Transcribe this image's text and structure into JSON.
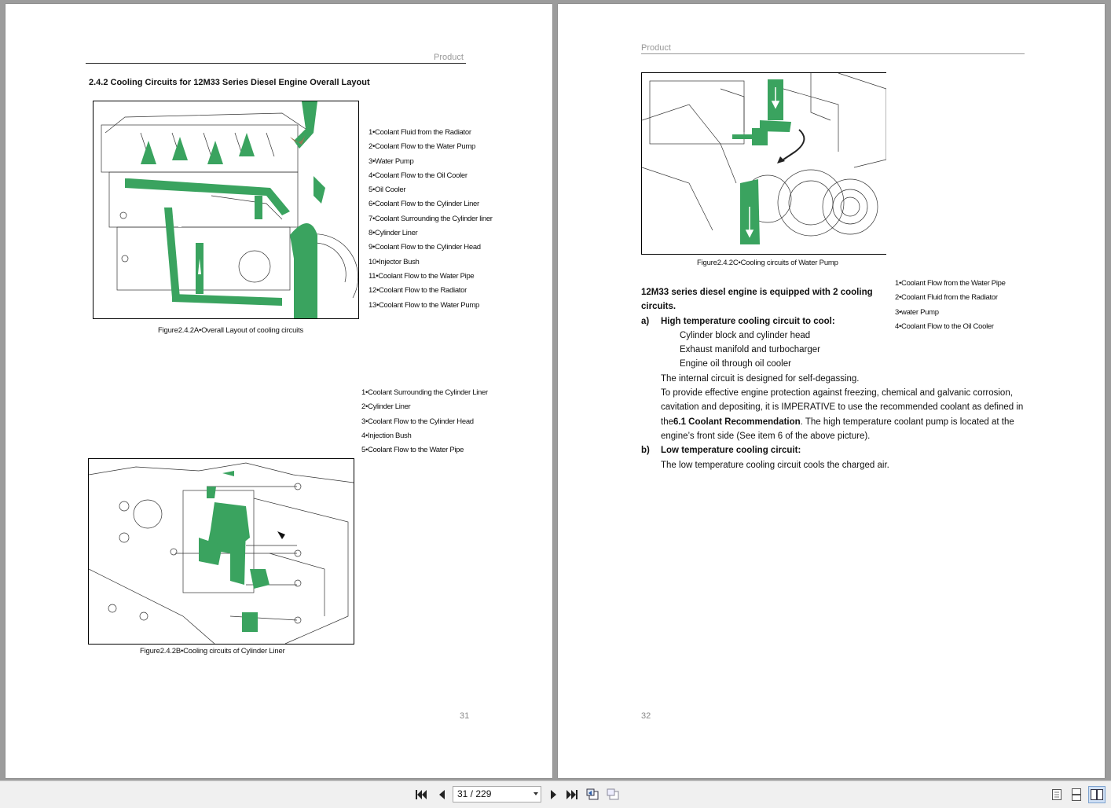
{
  "left_page": {
    "header": "Product",
    "section_title": "2.4.2 Cooling Circuits for 12M33 Series Diesel Engine Overall Layout",
    "figure_a_legend": [
      "1•Coolant Fluid from the Radiator",
      "2•Coolant Flow to the Water Pump",
      "3•Water Pump",
      "4•Coolant Flow to the Oil Cooler",
      "5•Oil Cooler",
      "6•Coolant Flow to the Cylinder Liner",
      "7•Coolant Surrounding the Cylinder liner",
      "8•Cylinder Liner",
      "9•Coolant Flow to the Cylinder Head",
      "10•Injector Bush",
      "11•Coolant Flow to the Water Pipe",
      "12•Coolant Flow to the Radiator",
      "13•Coolant Flow to the Water Pump"
    ],
    "figure_a_caption": "Figure2.4.2A•Overall Layout of cooling circuits",
    "figure_b_legend": [
      "1•Coolant Surrounding the Cylinder Liner",
      "2•Cylinder Liner",
      "3•Coolant Flow to the Cylinder Head",
      "4•Injection Bush",
      "5•Coolant Flow to the Water Pipe"
    ],
    "figure_b_caption": "Figure2.4.2B•Cooling circuits of Cylinder Liner",
    "page_number": "31"
  },
  "right_page": {
    "header": "Product",
    "figure_c_caption": "Figure2.4.2C•Cooling circuits of Water Pump",
    "figure_c_legend": [
      "1•Coolant Flow from the Water Pipe",
      "2•Coolant Fluid from the Radiator",
      "3•water Pump",
      "4•Coolant Flow to the Oil Cooler"
    ],
    "intro_line1": "12M33 series diesel engine is equipped with 2 cooling",
    "intro_line2": "circuits.",
    "item_a_marker": "a)",
    "item_a_title": "High temperature cooling circuit to cool:",
    "bullet_char": "",
    "bullets": [
      "Cylinder block and cylinder head",
      "Exhaust manifold and turbocharger",
      "Engine oil through oil cooler"
    ],
    "para1": "The internal circuit is designed for self-degassing.",
    "para2_line1": "To provide effective engine protection against freezing, chemical and galvanic corrosion,",
    "para2_line2": "cavitation and depositing, it is IMPERATIVE to use the recommended coolant as defined in",
    "para2_line3_pre": "the",
    "para2_line3_bold": "6.1 Coolant Recommendation",
    "para2_line3_post": ". The high temperature coolant pump is located at the",
    "para2_line4": "engine’s front side (See item 6 of the above picture).",
    "item_b_marker": "b)",
    "item_b_title": "Low temperature cooling circuit:",
    "item_b_text": "The low temperature cooling circuit cools the charged air.",
    "page_number": "32"
  },
  "toolbar": {
    "page_indicator": "31 / 229"
  },
  "colors": {
    "accent_green": "#3aa35f",
    "viewer_bg": "#9c9c9c"
  }
}
